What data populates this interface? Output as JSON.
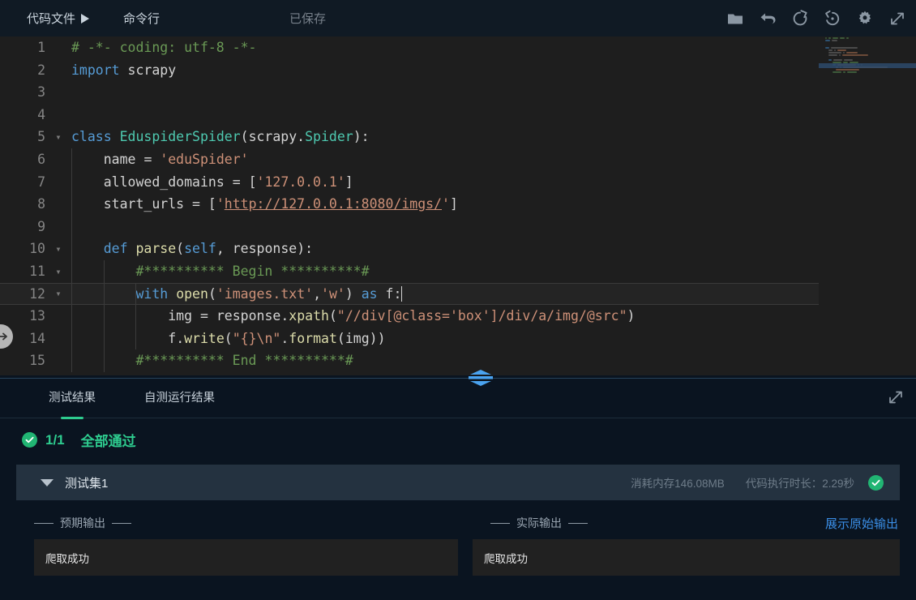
{
  "header": {
    "code_file_label": "代码文件",
    "command_line_label": "命令行",
    "saved_label": "已保存",
    "icons": [
      "folder-icon",
      "undo-icon",
      "refresh-icon",
      "history-icon",
      "gear-icon",
      "fullscreen-icon"
    ]
  },
  "editor": {
    "language": "python",
    "cursor_line": 12,
    "lines": [
      {
        "num": "1",
        "fold": "",
        "indent": 0,
        "text": "# -*- coding: utf-8 -*-"
      },
      {
        "num": "2",
        "fold": "",
        "indent": 0,
        "text": "import scrapy"
      },
      {
        "num": "3",
        "fold": "",
        "indent": 0,
        "text": ""
      },
      {
        "num": "4",
        "fold": "",
        "indent": 0,
        "text": ""
      },
      {
        "num": "5",
        "fold": "v",
        "indent": 0,
        "text": "class EduspiderSpider(scrapy.Spider):"
      },
      {
        "num": "6",
        "fold": "",
        "indent": 1,
        "text": "    name = 'eduSpider'"
      },
      {
        "num": "7",
        "fold": "",
        "indent": 1,
        "text": "    allowed_domains = ['127.0.0.1']"
      },
      {
        "num": "8",
        "fold": "",
        "indent": 1,
        "text": "    start_urls = ['http://127.0.0.1:8080/imgs/']"
      },
      {
        "num": "9",
        "fold": "",
        "indent": 1,
        "text": ""
      },
      {
        "num": "10",
        "fold": "v",
        "indent": 1,
        "text": "    def parse(self, response):"
      },
      {
        "num": "11",
        "fold": "v",
        "indent": 2,
        "text": "        #********** Begin **********#"
      },
      {
        "num": "12",
        "fold": "v",
        "indent": 3,
        "text": "        with open('images.txt','w') as f:"
      },
      {
        "num": "13",
        "fold": "",
        "indent": 3,
        "text": "            img = response.xpath(\"//div[@class='box']/div/a/img/@src\")"
      },
      {
        "num": "14",
        "fold": "",
        "indent": 3,
        "text": "            f.write(\"{}\\n\".format(img))"
      },
      {
        "num": "15",
        "fold": "",
        "indent": 2,
        "text": "        #********** End **********#"
      }
    ]
  },
  "results": {
    "tabs": [
      {
        "label": "测试结果",
        "active": true
      },
      {
        "label": "自测运行结果",
        "active": false
      }
    ],
    "expand_icon": "expand-icon",
    "summary": {
      "passed_ratio": "1/1",
      "status_text": "全部通过",
      "status_color": "#2ecc8f"
    },
    "testset": {
      "name": "测试集1",
      "memory": "消耗内存146.08MB",
      "duration": "代码执行时长：2.29秒",
      "status_icon": "check-circle-icon"
    },
    "expected": {
      "title": "预期输出",
      "content": "爬取成功"
    },
    "actual": {
      "title": "实际输出",
      "content": "爬取成功",
      "raw_link": "展示原始输出"
    }
  }
}
